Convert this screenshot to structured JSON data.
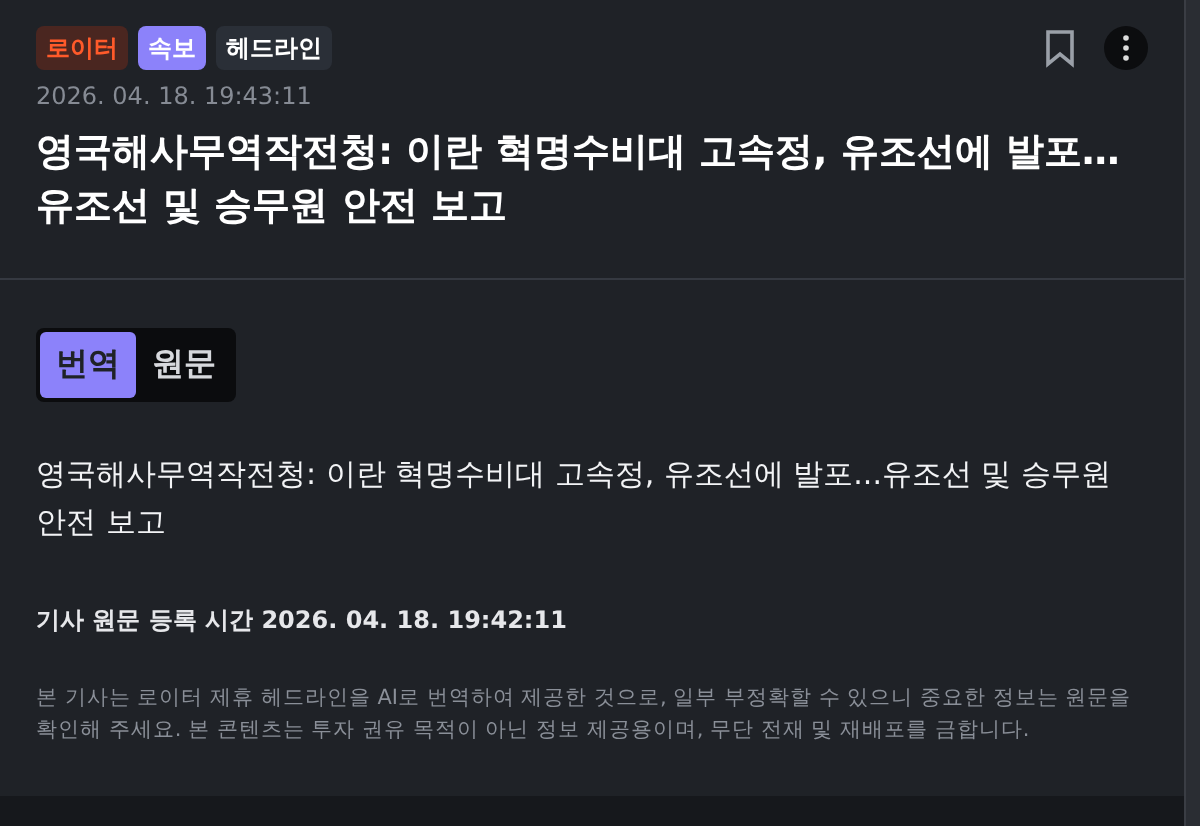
{
  "tags": [
    {
      "label": "로이터",
      "kind": "soft",
      "color": "#4a2620"
    },
    {
      "label": "속보",
      "kind": "solid",
      "color": "#8c82fa"
    },
    {
      "label": "헤드라인",
      "kind": "plain",
      "color": "#2a2f37"
    }
  ],
  "timestamp": "2026. 04. 18. 19:43:11",
  "headline": "영국해사무역작전청: 이란 혁명수비대 고속정, 유조선에 발포…유조선 및 승무원 안전 보고",
  "language_toggle": [
    {
      "label": "번역",
      "selected": true
    },
    {
      "label": "원문",
      "selected": false
    }
  ],
  "body": "영국해사무역작전청: 이란 혁명수비대 고속정, 유조선에 발포...유조선 및 승무원 안전 보고",
  "original_time": "기사 원문 등록 시간 2026. 04. 18. 19:42:11",
  "disclaimer": "본 기사는 로이터 제휴 헤드라인을 AI로 번역하여 제공한 것으로, 일부 부정확할 수 있으니 중요한 정보는 원문을 확인해 주세요. 본 콘텐츠는 투자 권유 목적이 아닌 정보 제공용이며, 무단 전재 및 재배포를 금합니다."
}
